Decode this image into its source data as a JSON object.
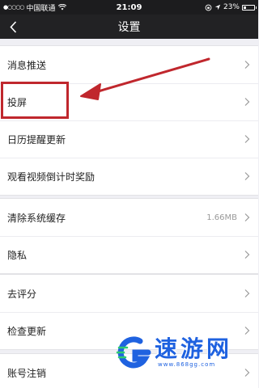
{
  "status_bar": {
    "signal": "●○○○○",
    "carrier": "中国联通",
    "wifi_icon": "wifi-icon",
    "time": "21:09",
    "battery_percent": "23%",
    "battery_level": 0.23
  },
  "nav": {
    "title": "设置",
    "back_icon": "chevron-left-icon"
  },
  "groups": [
    {
      "items": [
        {
          "label": "消息推送"
        },
        {
          "label": "投屏"
        },
        {
          "label": "日历提醒更新"
        },
        {
          "label": "观看视频倒计时奖励"
        }
      ]
    },
    {
      "items": [
        {
          "label": "清除系统缓存",
          "value": "1.66MB"
        },
        {
          "label": "隐私"
        }
      ]
    },
    {
      "items": [
        {
          "label": "去评分"
        },
        {
          "label": "检查更新"
        }
      ]
    },
    {
      "items": [
        {
          "label": "账号注销"
        }
      ]
    }
  ],
  "annotation": {
    "highlight_color": "#c0272d"
  },
  "watermark": {
    "brand": "速游网",
    "url": "www.868gg.com",
    "color": "#1f62e0"
  }
}
